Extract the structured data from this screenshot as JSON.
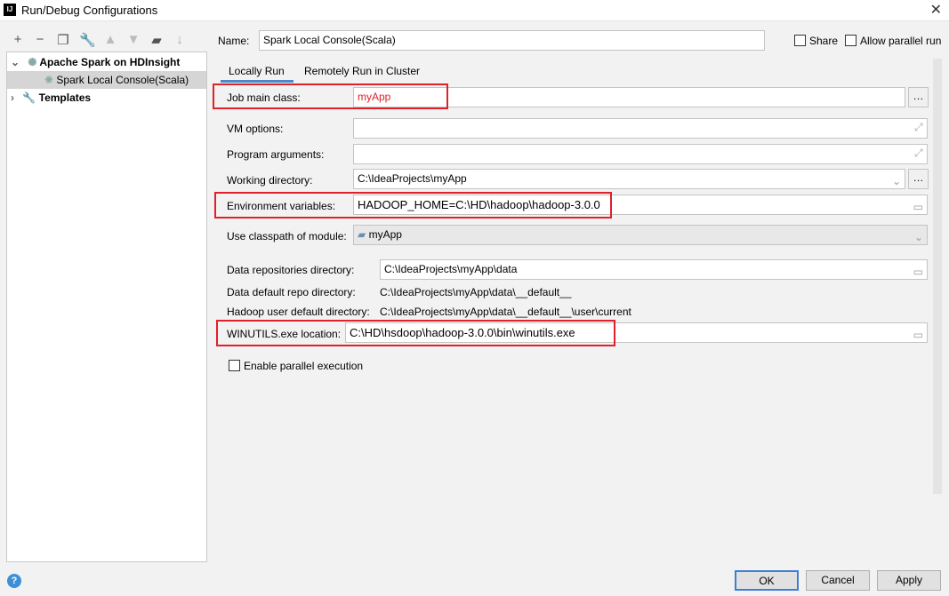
{
  "window": {
    "title": "Run/Debug Configurations",
    "logo": "IJ"
  },
  "toolbar": {
    "icons": [
      "plus-icon",
      "minus-icon",
      "copy-icon",
      "wrench-icon",
      "arrow-up-icon",
      "arrow-down-icon",
      "new-folder-icon",
      "sort-icon"
    ]
  },
  "tree": {
    "group": "Apache Spark on HDInsight",
    "child": "Spark Local Console(Scala)",
    "templates": "Templates"
  },
  "name": {
    "label": "Name:",
    "value": "Spark Local Console(Scala)",
    "share": "Share",
    "parallel": "Allow parallel run"
  },
  "tabs": [
    {
      "label": "Locally Run",
      "active": true
    },
    {
      "label": "Remotely Run in Cluster",
      "active": false
    }
  ],
  "form": {
    "main_class": {
      "label": "Job main class:",
      "value": "myApp"
    },
    "vm": {
      "label": "VM options:",
      "value": ""
    },
    "args": {
      "label": "Program arguments:",
      "value": ""
    },
    "workdir": {
      "label": "Working directory:",
      "value": "C:\\IdeaProjects\\myApp"
    },
    "env": {
      "label": "Environment variables:",
      "value": "HADOOP_HOME=C:\\HD\\hadoop\\hadoop-3.0.0"
    },
    "module": {
      "label": "Use classpath of module:",
      "value": "myApp"
    },
    "data_repo": {
      "label": "Data repositories directory:",
      "value": "C:\\IdeaProjects\\myApp\\data"
    },
    "default_repo": {
      "label": "Data default repo directory:",
      "value": "C:\\IdeaProjects\\myApp\\data\\__default__"
    },
    "hadoop_user": {
      "label": "Hadoop user default directory:",
      "value": "C:\\IdeaProjects\\myApp\\data\\__default__\\user\\current"
    },
    "winutils": {
      "label": "WINUTILS.exe location:",
      "value": "C:\\HD\\hsdoop\\hadoop-3.0.0\\bin\\winutils.exe"
    },
    "enable_parallel": "Enable parallel execution"
  },
  "buttons": {
    "ok": "OK",
    "cancel": "Cancel",
    "apply": "Apply",
    "help": "?"
  },
  "colors": {
    "highlight": "#e0202a",
    "selection": "#d5d5d5"
  }
}
